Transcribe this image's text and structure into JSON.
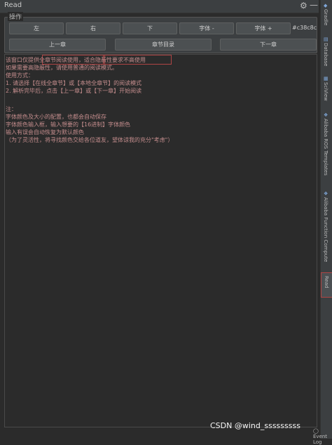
{
  "window": {
    "title": "Read"
  },
  "ops": {
    "legend": "操作",
    "left": "左",
    "right": "右",
    "down": "下",
    "font_minus": "字体 -",
    "font_plus": "字体 +",
    "color_value": "#c38c8c",
    "prev": "上一章",
    "toc": "章节目录",
    "next": "下一章"
  },
  "content": {
    "lines": [
      "该窗口仅提供全章节阅读使用，适合隐蔽性要求不高使用",
      "如果需要高隐蔽性，请使用普通的阅读模式。",
      "使用方式：",
      " 1. 请选择【在线全章节】或【本地全章节】的阅读模式",
      " 2. 解析完毕后，点击【上一章】或【下一章】开始阅读",
      "",
      "注：",
      "字体颜色及大小的配置，也都会自动保存",
      "字体颜色输入框，输入想要的【16进制】字体颜色",
      "输入有误会自动恢复为默认颜色",
      "（为了灵活性，将寻找颜色交给各位道友，望体谅我的充分\"考虑\"）"
    ],
    "text_color": "#c38c8c"
  },
  "sidebar": {
    "tabs": [
      "Gradle",
      "Database",
      "SciView",
      "Alibaba ROS Templates",
      "Alibaba Function Compute",
      "Read"
    ]
  },
  "statusbar": {
    "event_log": "Event Log"
  },
  "watermark": "CSDN @wind_sssssssss"
}
